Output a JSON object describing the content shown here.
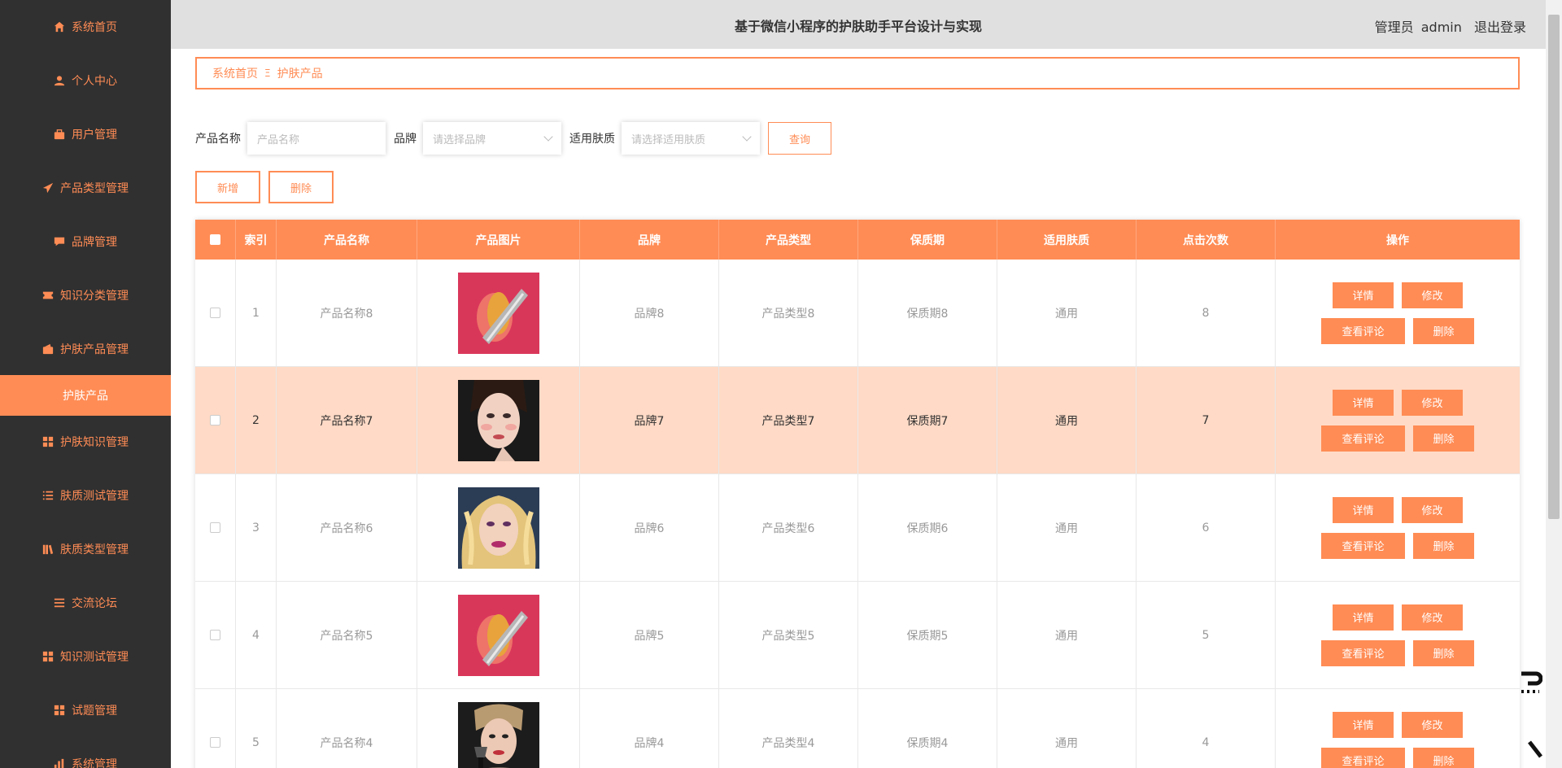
{
  "header": {
    "title": "基于微信小程序的护肤助手平台设计与实现",
    "role": "管理员",
    "username": "admin",
    "logout": "退出登录"
  },
  "sidebar": {
    "items": [
      {
        "label": "系统首页",
        "icon": "home-icon"
      },
      {
        "label": "个人中心",
        "icon": "user-icon"
      },
      {
        "label": "用户管理",
        "icon": "briefcase-icon"
      },
      {
        "label": "产品类型管理",
        "icon": "send-icon"
      },
      {
        "label": "品牌管理",
        "icon": "chat-icon"
      },
      {
        "label": "知识分类管理",
        "icon": "ticket-icon"
      },
      {
        "label": "护肤产品管理",
        "icon": "wallet-icon"
      }
    ],
    "active_sub": "护肤产品",
    "items2": [
      {
        "label": "护肤知识管理",
        "icon": "grid-icon"
      },
      {
        "label": "肤质测试管理",
        "icon": "list-icon"
      },
      {
        "label": "肤质类型管理",
        "icon": "books-icon"
      },
      {
        "label": "交流论坛",
        "icon": "menu-icon"
      },
      {
        "label": "知识测试管理",
        "icon": "grid-icon"
      },
      {
        "label": "试题管理",
        "icon": "grid-icon"
      },
      {
        "label": "系统管理",
        "icon": "bar-chart-icon"
      }
    ]
  },
  "breadcrumb": {
    "home": "系统首页",
    "sep": "Ξ",
    "current": "护肤产品"
  },
  "search": {
    "name_label": "产品名称",
    "name_placeholder": "产品名称",
    "brand_label": "品牌",
    "brand_placeholder": "请选择品牌",
    "skin_label": "适用肤质",
    "skin_placeholder": "请选择适用肤质",
    "query": "查询"
  },
  "actions": {
    "add": "新增",
    "delete": "删除"
  },
  "table": {
    "headers": [
      "索引",
      "产品名称",
      "产品图片",
      "品牌",
      "产品类型",
      "保质期",
      "适用肤质",
      "点击次数",
      "操作"
    ],
    "rows": [
      {
        "idx": "1",
        "name": "产品名称8",
        "image": "lipstick-image",
        "brand": "品牌8",
        "type": "产品类型8",
        "shelf": "保质期8",
        "skin": "通用",
        "clicks": "8"
      },
      {
        "idx": "2",
        "name": "产品名称7",
        "image": "makeup-face-image",
        "brand": "品牌7",
        "type": "产品类型7",
        "shelf": "保质期7",
        "skin": "通用",
        "clicks": "7"
      },
      {
        "idx": "3",
        "name": "产品名称6",
        "image": "blonde-face-image",
        "brand": "品牌6",
        "type": "产品类型6",
        "shelf": "保质期6",
        "skin": "通用",
        "clicks": "6"
      },
      {
        "idx": "4",
        "name": "产品名称5",
        "image": "lipstick-image",
        "brand": "品牌5",
        "type": "产品类型5",
        "shelf": "保质期5",
        "skin": "通用",
        "clicks": "5"
      },
      {
        "idx": "5",
        "name": "产品名称4",
        "image": "brush-face-image",
        "brand": "品牌4",
        "type": "产品类型4",
        "shelf": "保质期4",
        "skin": "通用",
        "clicks": "4"
      }
    ],
    "ops": {
      "detail": "详情",
      "edit": "修改",
      "comments": "查看评论",
      "delete": "删除"
    }
  },
  "colors": {
    "accent": "#ff8c55",
    "sidebar_bg": "#303030",
    "header_bg": "#e0e0e0",
    "highlight_row": "#ffdac6"
  }
}
